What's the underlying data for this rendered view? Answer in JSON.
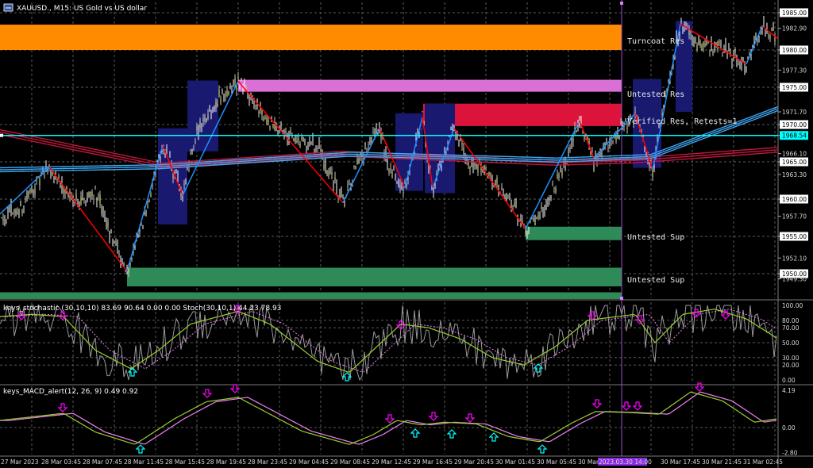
{
  "header": {
    "symbol_label": "XAUUSD., M15:  US Gold vs US dollar",
    "icon": "chart-window-icon"
  },
  "colors": {
    "background": "#000000",
    "grid": "#5a5a5a",
    "orange_zone": "#ff8c00",
    "pink_zone": "#da70d6",
    "red_zone": "#dc143c",
    "green_zone": "#2e8b57",
    "navy_box": "#191970",
    "current_price_line": "#00ffff",
    "zigzag_up": "#1e90ff",
    "zigzag_down": "#ff0000",
    "stoch_main": "#9acd32",
    "stoch_signal": "#ee82ee",
    "arrow_down": "#ff00ff",
    "arrow_up": "#00ffff"
  },
  "zones": [
    {
      "label": "Turncoat Res",
      "color": "orange"
    },
    {
      "label": "Untested Res",
      "color": "pink"
    },
    {
      "label": "Verified Res, Retests=1",
      "color": "red"
    },
    {
      "label": "Untested Sup",
      "color": "green"
    },
    {
      "label": "Untested Sup",
      "color": "green"
    }
  ],
  "price_axis": {
    "ticks": [
      "1985.00",
      "1982.90",
      "1980.00",
      "1977.30",
      "1975.00",
      "1971.70",
      "1970.00",
      "1968.54",
      "1966.10",
      "1965.00",
      "1963.30",
      "1960.00",
      "1957.70",
      "1955.00",
      "1952.10",
      "1950.00",
      "1949.30"
    ],
    "boxed": [
      "1985.00",
      "1980.00",
      "1975.00",
      "1970.00",
      "1968.54",
      "1965.00",
      "1960.00",
      "1955.00",
      "1950.00"
    ],
    "current_price": "1968.54"
  },
  "stochastic": {
    "label": "keys_stochastic (30,10,10) 83.69 90.64 0.00 0.00 Stoch(30,10,1) 44.23 78.93",
    "levels": [
      "100.00",
      "80.00",
      "70.00",
      "50.00",
      "30.00",
      "20.00",
      "0.00"
    ]
  },
  "macd": {
    "label": "keys_MACD_alert(12, 26, 9) 0.49 0.92",
    "levels": [
      "4.19",
      "0.00",
      "-2.80"
    ]
  },
  "time_axis": {
    "labels": [
      "27 Mar 2023",
      "28 Mar 03:45",
      "28 Mar 07:45",
      "28 Mar 11:45",
      "28 Mar 15:45",
      "28 Mar 19:45",
      "28 Mar 23:45",
      "29 Mar 04:45",
      "29 Mar 08:45",
      "29 Mar 12:45",
      "29 Mar 16:45",
      "29 Mar 20:45",
      "30 Mar 01:45",
      "30 Mar 05:45",
      "30 Mar 09:45",
      "2023.03.30 14:00",
      "30 Mar 17:45",
      "30 Mar 21:45",
      "31 Mar 02:45"
    ],
    "highlight": "2023.03.30 14:00"
  }
}
